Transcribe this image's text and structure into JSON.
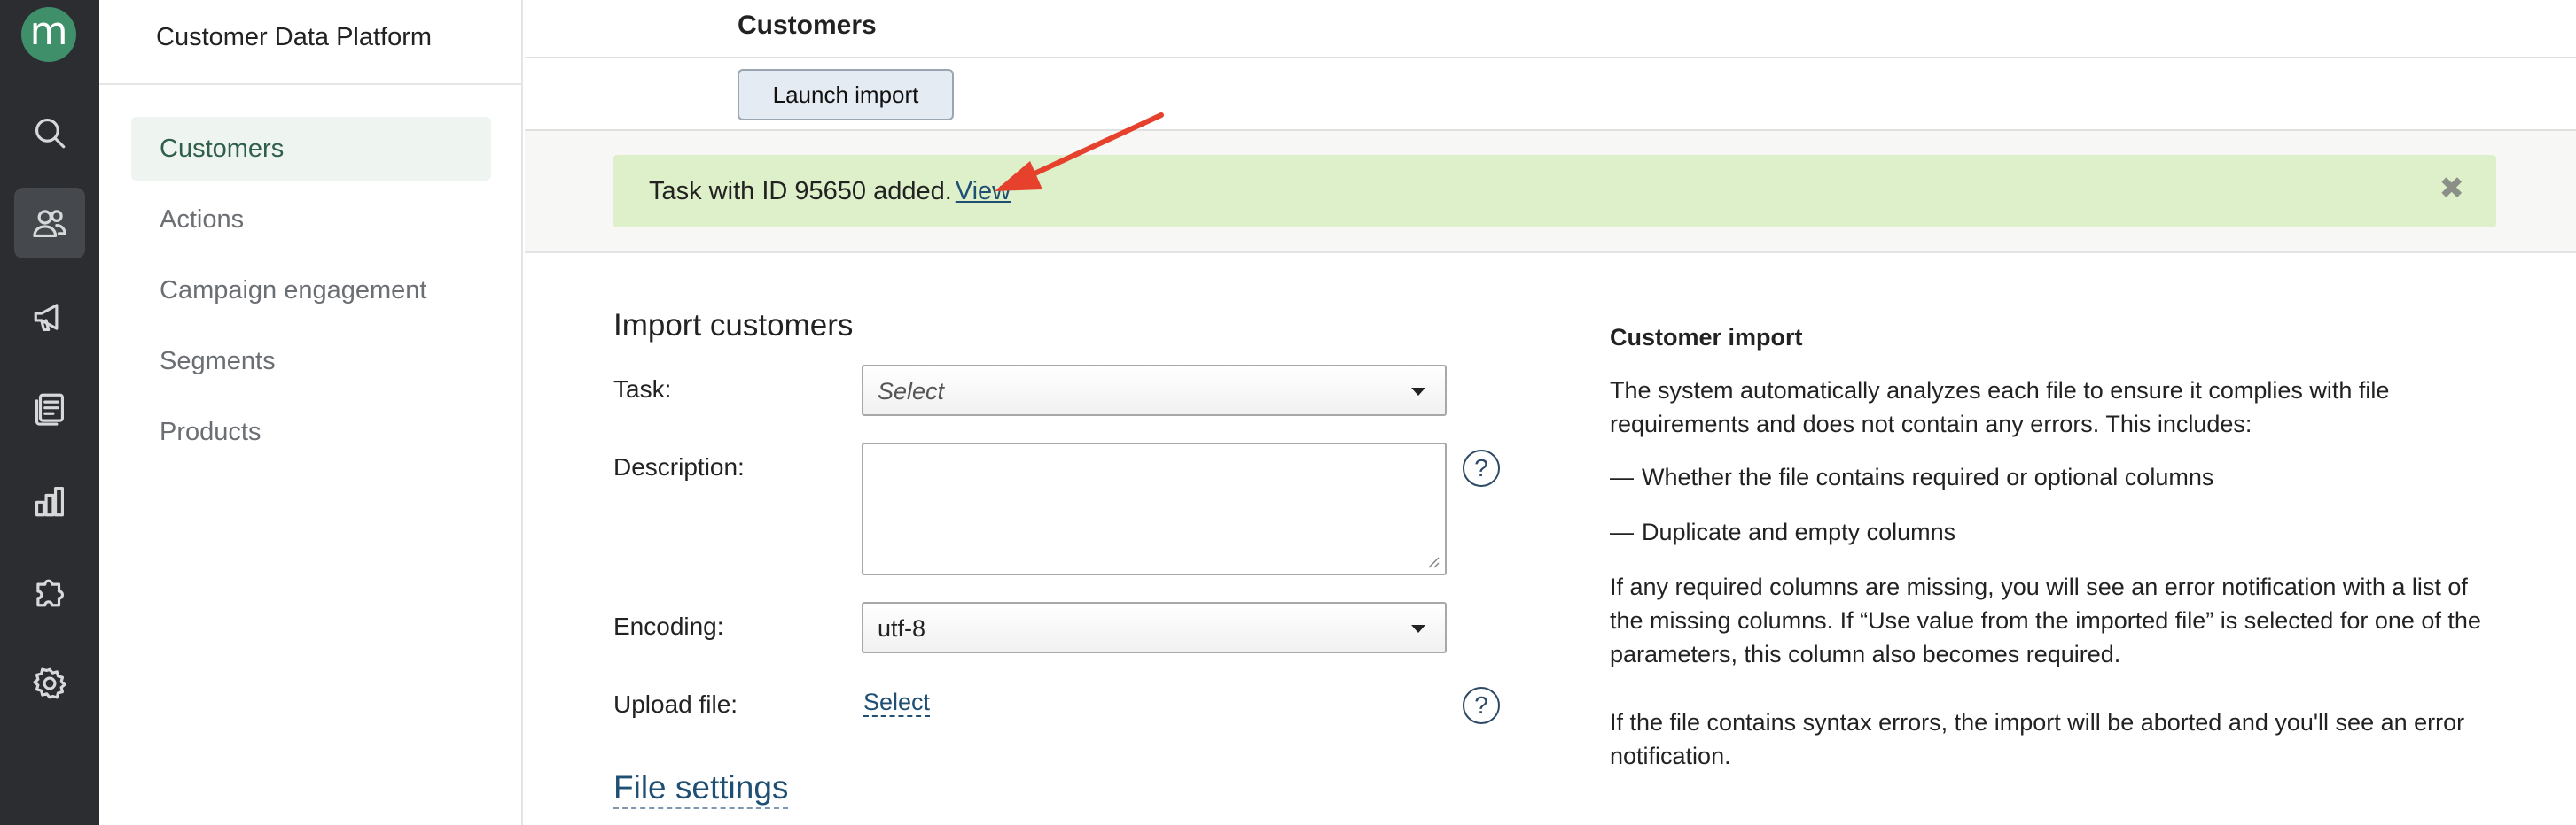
{
  "rail": {
    "logo_letter": "m",
    "icons": [
      "search-icon",
      "users-icon",
      "megaphone-icon",
      "documents-icon",
      "bar-chart-icon",
      "puzzle-icon",
      "gear-icon"
    ],
    "active_icon": "users-icon"
  },
  "nav": {
    "title": "Customer Data Platform",
    "items": [
      {
        "label": "Customers",
        "active": true
      },
      {
        "label": "Actions"
      },
      {
        "label": "Campaign engagement"
      },
      {
        "label": "Segments"
      },
      {
        "label": "Products"
      }
    ]
  },
  "header": {
    "title": "Customers",
    "launch_label": "Launch import"
  },
  "notice": {
    "text": "Task with ID 95650 added.",
    "link": "View",
    "close": "✖"
  },
  "form": {
    "title": "Import customers",
    "task_label": "Task:",
    "task_placeholder": "Select",
    "description_label": "Description:",
    "encoding_label": "Encoding:",
    "encoding_value": "utf-8",
    "upload_label": "Upload file:",
    "upload_link": "Select",
    "help_glyph": "?",
    "file_settings": "File settings"
  },
  "info": {
    "title": "Customer import",
    "p1": "The system automatically analyzes each file to ensure it complies with file requirements and does not contain any errors. This includes:",
    "dash": "—",
    "bullet1": "Whether the file contains required or optional columns",
    "bullet2": "Duplicate and empty columns",
    "p2": "If any required columns are missing, you will see an error notification with a list of the missing columns. If “Use value from the imported file” is selected for one of the parameters, this column also becomes required.",
    "p3": "If the file contains syntax errors, the import will be aborted and you'll see an error notification."
  },
  "colors": {
    "rail_bg": "#2b2d30",
    "logo": "#3f8f6a",
    "notice_bg": "#def0c9",
    "link": "#1f4f73",
    "arrow": "#e5412c"
  }
}
